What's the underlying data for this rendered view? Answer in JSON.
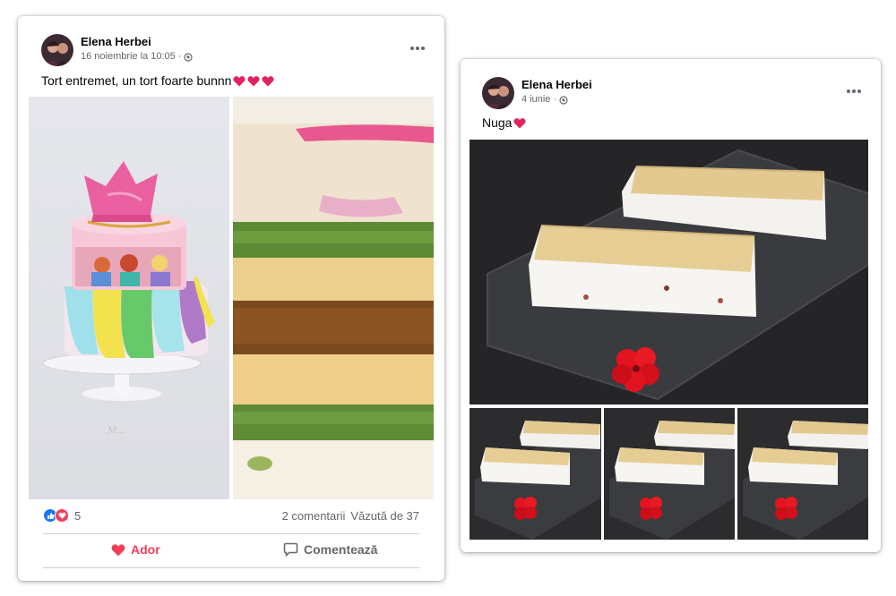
{
  "posts": [
    {
      "author": "Elena Herbei",
      "date": "16 noiembrie la 10:05",
      "separator": "·",
      "text": "Tort entremet, un tort foarte bunnn",
      "reaction_count": "5",
      "comments": "2 comentarii",
      "views": "Văzută de 37",
      "actions": {
        "love": "Ador",
        "comment": "Comentează"
      }
    },
    {
      "author": "Elena Herbei",
      "date": "4 iunie",
      "separator": "·",
      "text": "Nuga"
    }
  ],
  "colors": {
    "love": "#f33e58",
    "like": "#1877f2",
    "secondary_text": "#65676b"
  }
}
